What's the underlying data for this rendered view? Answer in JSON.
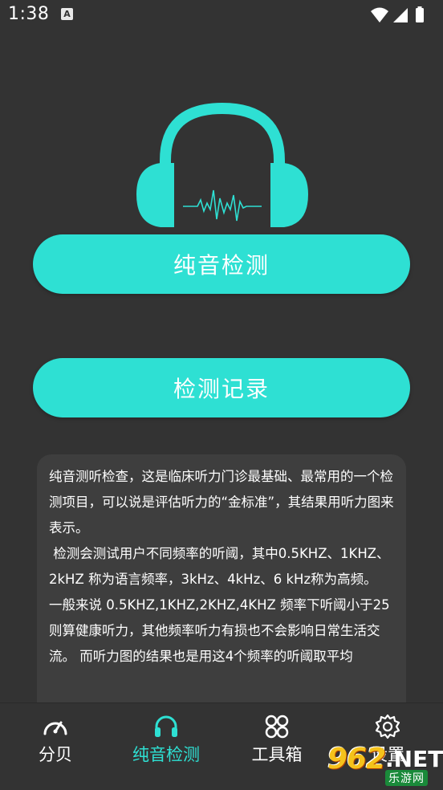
{
  "status_bar": {
    "time": "1:38",
    "notification_badge": "A",
    "icons": [
      "wifi-icon",
      "cell-signal-icon",
      "battery-icon"
    ]
  },
  "logo": {
    "icon": "headphones-waveform-icon",
    "color": "#2ee0d3"
  },
  "buttons": {
    "pure_tone_test": "纯音检测",
    "test_record": "检测记录"
  },
  "info": {
    "paragraphs": [
      "纯音测听检查，这是临床听力门诊最基础、最常用的一个检测项目，可以说是评估听力的“金标准”，其结果用听力图来表示。",
      " 检测会测试用户不同频率的听阈，其中0.5KHZ、1KHZ、2kHZ 称为语言频率，3kHz、4kHz、6 kHz称为高频。",
      "一般来说 0.5KHZ,1KHZ,2KHZ,4KHZ 频率下听阈小于25则算健康听力，其他频率听力有损也不会影响日常生活交流。 而听力图的结果也是用这4个频率的听阈取平均"
    ]
  },
  "nav": {
    "items": [
      {
        "label": "分贝",
        "icon": "speedometer-icon"
      },
      {
        "label": "纯音检测",
        "icon": "headphones-icon",
        "active": true
      },
      {
        "label": "工具箱",
        "icon": "toolbox-grid-icon"
      },
      {
        "label": "设置",
        "icon": "gear-icon"
      }
    ]
  },
  "watermark": {
    "number": "962",
    "suffix": ".NET",
    "site": "乐游网"
  },
  "colors": {
    "accent": "#2ee0d3",
    "background": "#333333",
    "card": "#3e3e3e"
  }
}
